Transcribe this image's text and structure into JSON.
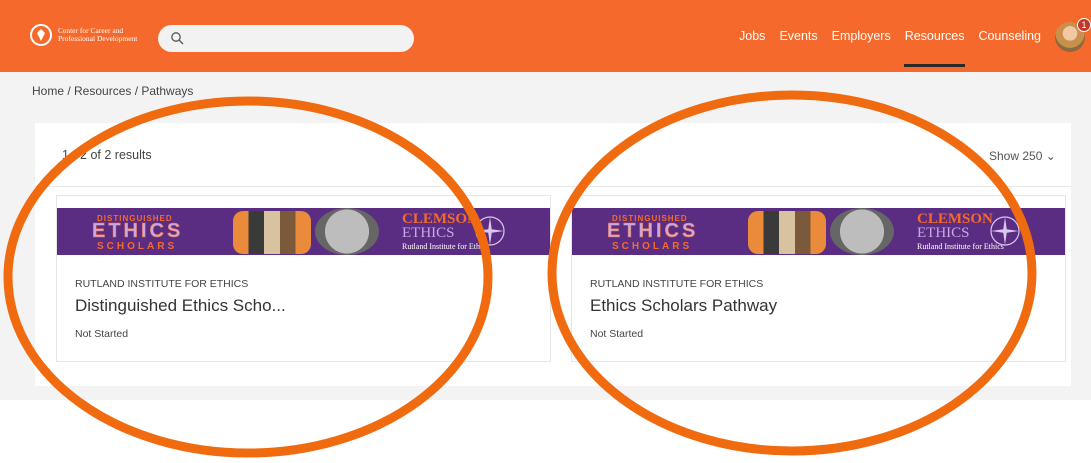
{
  "header": {
    "logo_text": "Center for Career and Professional Development",
    "search_placeholder": "",
    "nav": [
      {
        "label": "Jobs",
        "active": false
      },
      {
        "label": "Events",
        "active": false
      },
      {
        "label": "Employers",
        "active": false
      },
      {
        "label": "Resources",
        "active": true
      },
      {
        "label": "Counseling",
        "active": false
      }
    ],
    "notification_count": "1",
    "brand_color": "#f56a2c"
  },
  "breadcrumb": {
    "text": "Home / Resources / Pathways"
  },
  "results": {
    "summary": "1 - 2 of 2 results",
    "show_label": "Show 250 ⌄"
  },
  "cards": [
    {
      "banner": {
        "distinguished": "DISTINGUISHED",
        "ethics": "ETHICS",
        "scholars": "SCHOLARS",
        "clemson": "CLEMSON",
        "ethics2": "ETHICS",
        "rutland": "Rutland Institute for Ethics"
      },
      "institution": "RUTLAND INSTITUTE FOR ETHICS",
      "title": "Distinguished Ethics Scho...",
      "status": "Not Started"
    },
    {
      "banner": {
        "distinguished": "DISTINGUISHED",
        "ethics": "ETHICS",
        "scholars": "SCHOLARS",
        "clemson": "CLEMSON",
        "ethics2": "ETHICS",
        "rutland": "Rutland Institute for Ethics"
      },
      "institution": "RUTLAND INSTITUTE FOR ETHICS",
      "title": "Ethics Scholars Pathway",
      "status": "Not Started"
    }
  ],
  "annotation_color": "#f06b0f"
}
